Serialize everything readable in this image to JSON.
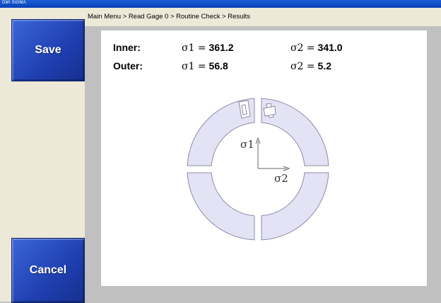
{
  "window": {
    "title": "DMI SIGMA"
  },
  "breadcrumb": "Main Menu > Read Gage 0 > Routine Check > Results",
  "buttons": {
    "save": "Save",
    "cancel": "Cancel"
  },
  "results": {
    "inner": {
      "label": "Inner:",
      "s1_sym": "σ1 =",
      "s1_val": "361.2",
      "s2_sym": "σ2 =",
      "s2_val": "341.0"
    },
    "outer": {
      "label": "Outer:",
      "s1_sym": "σ1 =",
      "s1_val": "56.8",
      "s2_sym": "σ2 =",
      "s2_val": "5.2"
    }
  },
  "diagram": {
    "axis1_label": "σ1",
    "axis2_label": "σ2",
    "segment_fill": "#e3e3f5",
    "segment_stroke": "#8c8ca6",
    "axis_color": "#666666"
  }
}
